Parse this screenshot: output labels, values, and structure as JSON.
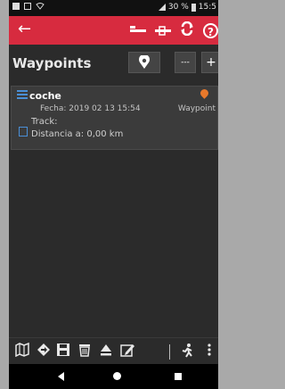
{
  "status": {
    "battery_text": "30 %",
    "time": "15:5"
  },
  "appbar": {
    "back_icon": "arrow-left-icon",
    "help_label": "?"
  },
  "header": {
    "title": "Waypoints",
    "minus_label": "---",
    "plus_label": "+"
  },
  "waypoint": {
    "name": "coche",
    "date": "Fecha: 2019 02 13 15:54",
    "type": "Waypoint",
    "track": "Track:",
    "distance": "Distancia a: 0,00 km"
  },
  "colors": {
    "accent_red": "#d72b3f",
    "link_blue": "#4a8fd6",
    "pin_orange": "#e8792b"
  }
}
